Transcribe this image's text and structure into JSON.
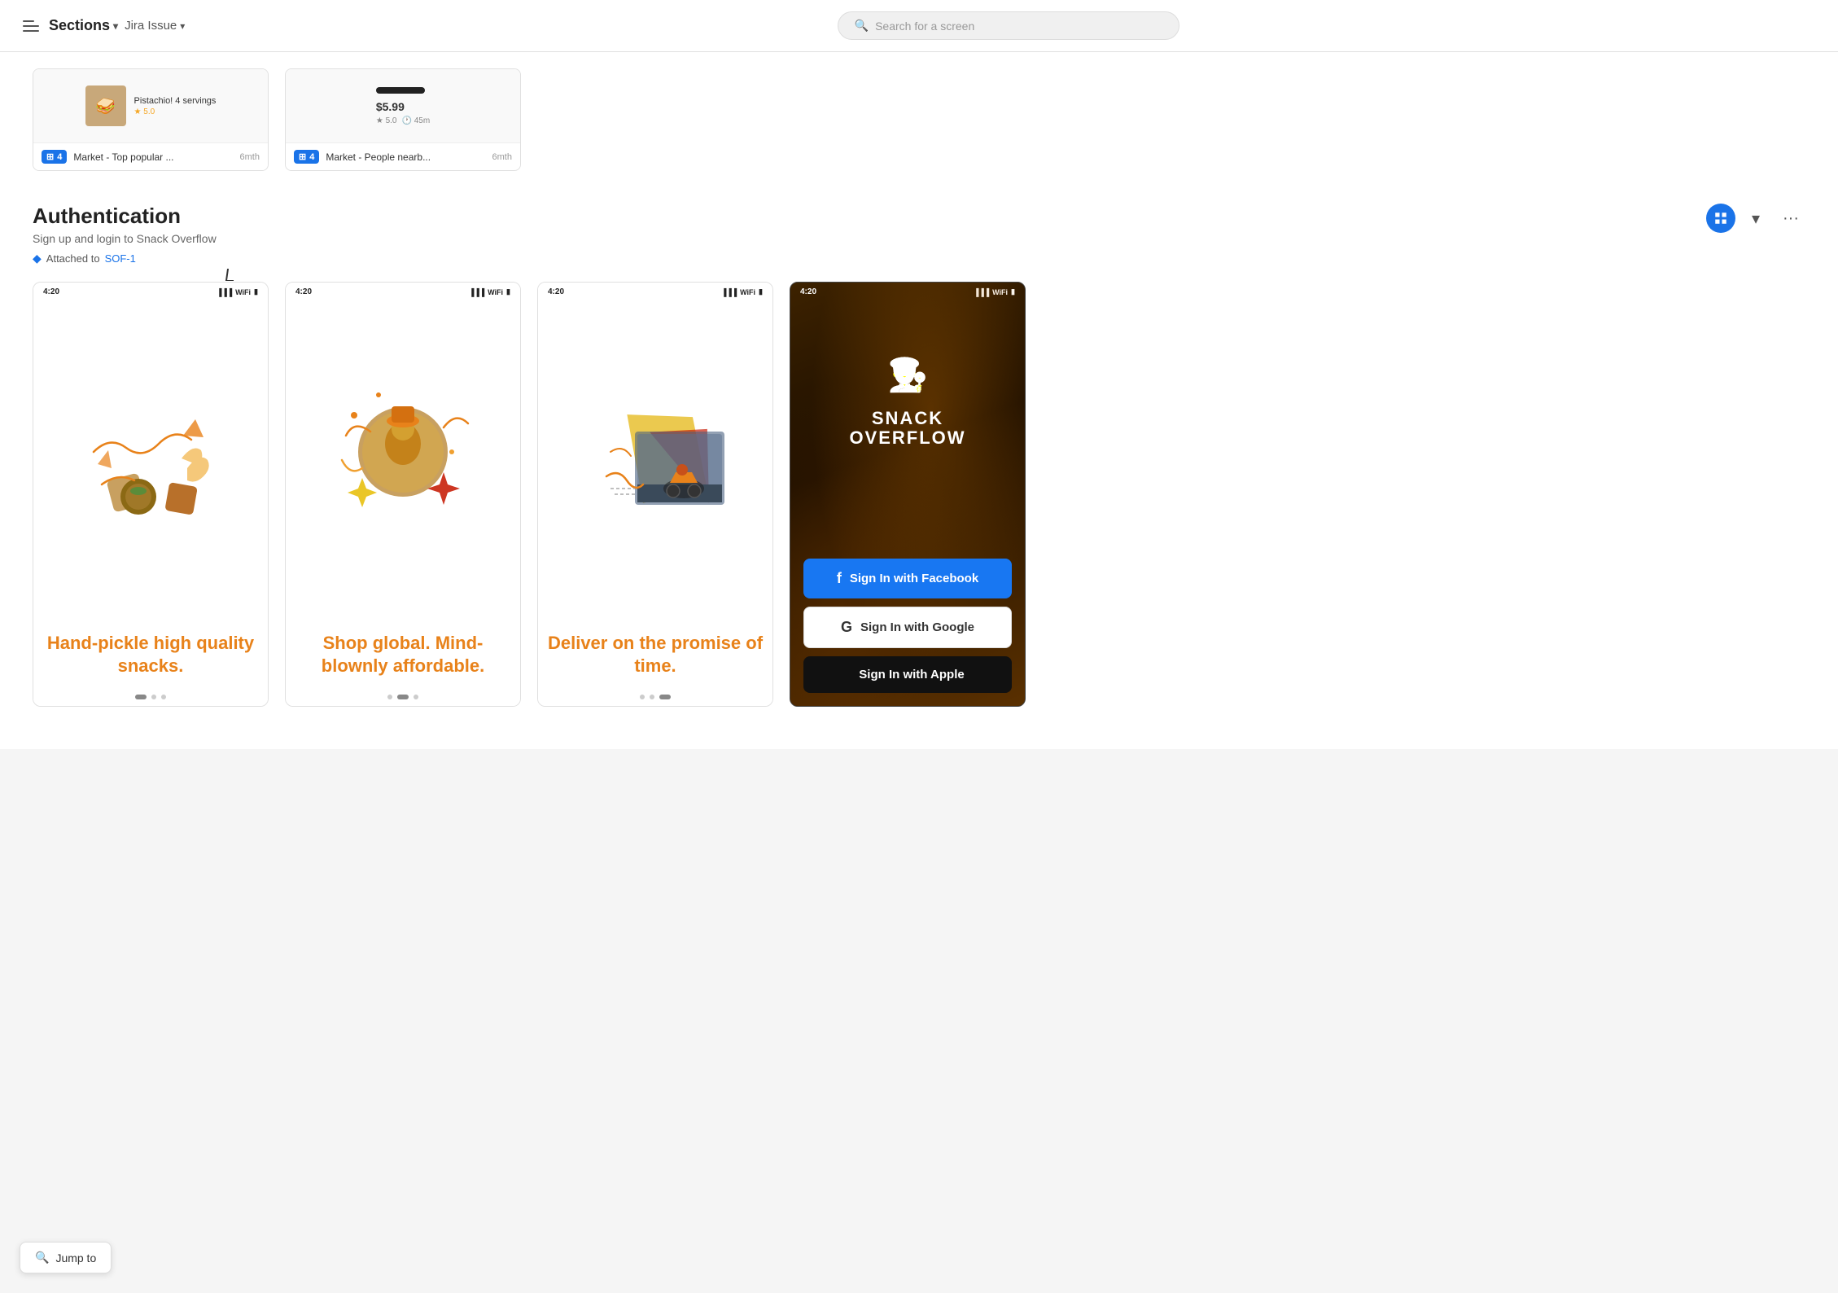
{
  "topbar": {
    "hamburger_label": "menu",
    "sections_label": "Sections",
    "jira_label": "Jira Issue",
    "search_placeholder": "Search for a screen"
  },
  "top_cards": [
    {
      "badge_count": "4",
      "title": "Market - Top popular ...",
      "date": "6mth",
      "food_name": "Pistachio! 4 servings",
      "stars": "5.0"
    },
    {
      "badge_count": "4",
      "title": "Market - People nearb...",
      "date": "6mth",
      "price": "$5.99",
      "stars": "5.0",
      "time": "45m"
    }
  ],
  "section": {
    "title": "Authentication",
    "description": "Sign up and login to Snack Overflow",
    "attached_label": "Attached to",
    "jira_ref": "SOF-1"
  },
  "screens": [
    {
      "id": "onboarding-1",
      "time": "4:20",
      "headline": "Hand-pickle high quality snacks.",
      "dots": [
        true,
        false,
        false
      ]
    },
    {
      "id": "onboarding-2",
      "time": "4:20",
      "headline": "Shop global. Mind-blownly affordable.",
      "dots": [
        false,
        true,
        false
      ]
    },
    {
      "id": "onboarding-3",
      "time": "4:20",
      "headline": "Deliver on the promise of time.",
      "dots": [
        false,
        false,
        true
      ]
    },
    {
      "id": "signin",
      "time": "4:20",
      "brand": "SNACK\nOVERFLOW",
      "facebook_btn": "Sign In with Facebook",
      "google_btn": "Sign In with Google",
      "apple_btn": "Sign In with Apple"
    }
  ],
  "jump_to": {
    "label": "Jump to"
  }
}
